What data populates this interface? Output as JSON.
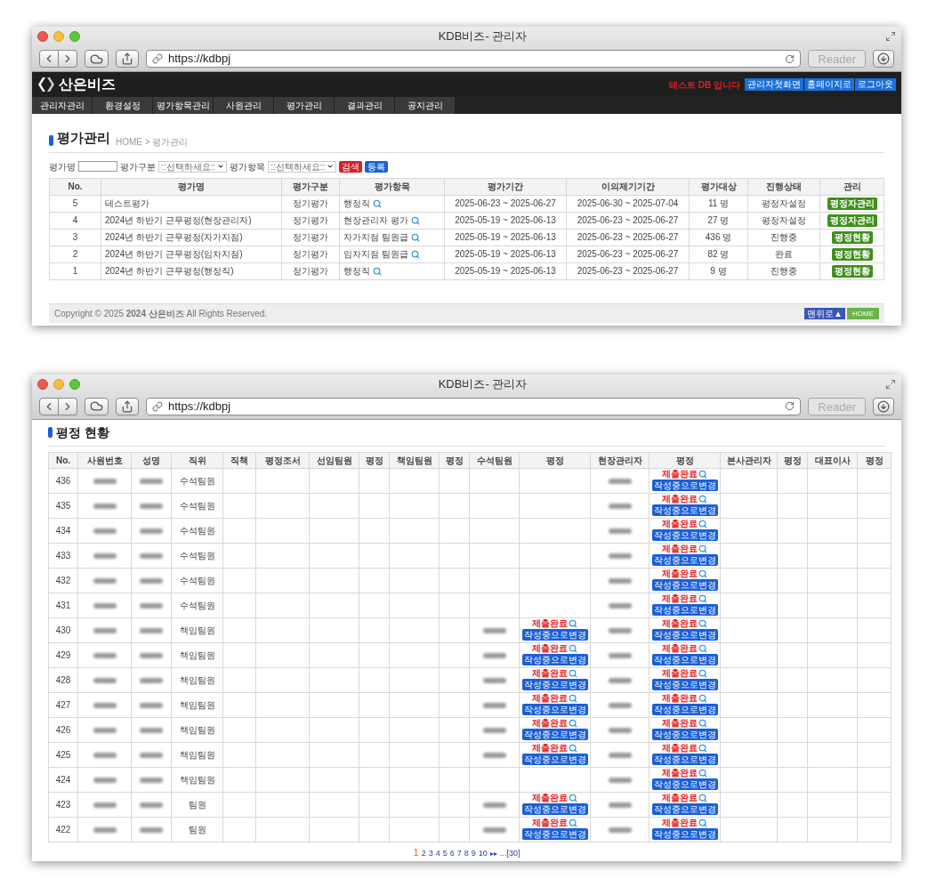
{
  "windows": [
    {
      "kind": "evaluation_list",
      "title": "KDB비즈- 관리자",
      "url": "https://kdbpj",
      "reader": "Reader",
      "brand": "산은비즈",
      "notice": "테스트 DB 입니다",
      "header_links": [
        "관리자첫화면",
        "홈페이지로",
        "로그아웃"
      ],
      "nav": [
        "관리자관리",
        "환경설정",
        "평가항목관리",
        "사원관리",
        "평가관리",
        "결과관리",
        "공지관리"
      ],
      "page_title": "평가관리",
      "breadcrumb": "HOME > 평가관리",
      "filters": [
        {
          "kind": "text",
          "label": "평가명"
        },
        {
          "kind": "select",
          "label": "평가구분",
          "placeholder": "::선택하세요::"
        },
        {
          "kind": "select",
          "label": "평가항목",
          "placeholder": "::선택하세요::"
        }
      ],
      "search_button": "검색",
      "register_button": "등록",
      "table": {
        "columns": [
          "No.",
          "평가명",
          "평가구분",
          "평가항목",
          "평가기간",
          "이의제기기간",
          "평가대상",
          "진행상태",
          "관리"
        ],
        "rows": [
          {
            "no": "5",
            "name": "테스트평가",
            "type": "정기평가",
            "item": "행정직",
            "period": "2025-06-23 ~ 2025-06-27",
            "objection_period": "2025-06-30 ~ 2025-07-04",
            "targets": "11 명",
            "status": "평정자설정",
            "action": "평정자관리"
          },
          {
            "no": "4",
            "name": "2024년 하반기 근무평정(현장관리자)",
            "type": "정기평가",
            "item": "현장관리자 평가",
            "period": "2025-05-19 ~ 2025-06-13",
            "objection_period": "2025-06-23 ~ 2025-06-27",
            "targets": "27 명",
            "status": "평정자설정",
            "action": "평정자관리"
          },
          {
            "no": "3",
            "name": "2024년 하반기 근무평정(자가지점)",
            "type": "정기평가",
            "item": "자가지점 팀원급",
            "period": "2025-05-19 ~ 2025-06-13",
            "objection_period": "2025-06-23 ~ 2025-06-27",
            "targets": "436 명",
            "status": "진행중",
            "action": "평정현황"
          },
          {
            "no": "2",
            "name": "2024년 하반기 근무평정(임차지점)",
            "type": "정기평가",
            "item": "임차지점 팀원급",
            "period": "2025-05-19 ~ 2025-06-13",
            "objection_period": "2025-06-23 ~ 2025-06-27",
            "targets": "82 명",
            "status": "완료",
            "action": "평정현황"
          },
          {
            "no": "1",
            "name": "2024년 하반기 근무평정(행정직)",
            "type": "정기평가",
            "item": "행정직",
            "period": "2025-05-19 ~ 2025-06-13",
            "objection_period": "2025-06-23 ~ 2025-06-27",
            "targets": "9 명",
            "status": "진행중",
            "action": "평정현황"
          }
        ]
      },
      "footer": {
        "copyright": "Copyright © 2025 **2024 산은비즈** All Rights Reserved.",
        "top_button": "맨위로▲",
        "home_button": "HOME"
      }
    },
    {
      "kind": "evaluation_status",
      "title": "KDB비즈- 관리자",
      "url": "https://kdbpj",
      "reader": "Reader",
      "page_title": "평정 현황",
      "table": {
        "columns": [
          "No.",
          "사원번호",
          "성명",
          "직위",
          "직책",
          "평정조서",
          "선임팀원",
          "평정",
          "책임팀원",
          "평정",
          "수석팀원",
          "평정",
          "현장관리자",
          "평정",
          "본사관리자",
          "평정",
          "대표이사",
          "평정"
        ],
        "rows": [
          {
            "no": "436",
            "position": "수석팀원",
            "site_manager_review": {
              "status": "제출완료",
              "action": "작성중으로변경"
            }
          },
          {
            "no": "435",
            "position": "수석팀원",
            "site_manager_review": {
              "status": "제출완료",
              "action": "작성중으로변경"
            }
          },
          {
            "no": "434",
            "position": "수석팀원",
            "site_manager_review": {
              "status": "제출완료",
              "action": "작성중으로변경"
            }
          },
          {
            "no": "433",
            "position": "수석팀원",
            "site_manager_review": {
              "status": "제출완료",
              "action": "작성중으로변경"
            }
          },
          {
            "no": "432",
            "position": "수석팀원",
            "site_manager_review": {
              "status": "제출완료",
              "action": "작성중으로변경"
            }
          },
          {
            "no": "431",
            "position": "수석팀원",
            "site_manager_review": {
              "status": "제출완료",
              "action": "작성중으로변경"
            }
          },
          {
            "no": "430",
            "position": "책임팀원",
            "chief_member_review": {
              "status": "제출완료",
              "action": "작성중으로변경"
            },
            "site_manager_review": {
              "status": "제출완료",
              "action": "작성중으로변경"
            }
          },
          {
            "no": "429",
            "position": "책임팀원",
            "chief_member_review": {
              "status": "제출완료",
              "action": "작성중으로변경"
            },
            "site_manager_review": {
              "status": "제출완료",
              "action": "작성중으로변경"
            }
          },
          {
            "no": "428",
            "position": "책임팀원",
            "chief_member_review": {
              "status": "제출완료",
              "action": "작성중으로변경"
            },
            "site_manager_review": {
              "status": "제출완료",
              "action": "작성중으로변경"
            }
          },
          {
            "no": "427",
            "position": "책임팀원",
            "chief_member_review": {
              "status": "제출완료",
              "action": "작성중으로변경"
            },
            "site_manager_review": {
              "status": "제출완료",
              "action": "작성중으로변경"
            }
          },
          {
            "no": "426",
            "position": "책임팀원",
            "chief_member_review": {
              "status": "제출완료",
              "action": "작성중으로변경"
            },
            "site_manager_review": {
              "status": "제출완료",
              "action": "작성중으로변경"
            }
          },
          {
            "no": "425",
            "position": "책임팀원",
            "chief_member_review": {
              "status": "제출완료",
              "action": "작성중으로변경"
            },
            "site_manager_review": {
              "status": "제출완료",
              "action": "작성중으로변경"
            }
          },
          {
            "no": "424",
            "position": "책임팀원",
            "site_manager_review": {
              "status": "제출완료",
              "action": "작성중으로변경"
            }
          },
          {
            "no": "423",
            "position": "팀원",
            "chief_member_review": {
              "status": "제출완료",
              "action": "작성중으로변경"
            },
            "site_manager_review": {
              "status": "제출완료",
              "action": "작성중으로변경"
            }
          },
          {
            "no": "422",
            "position": "팀원",
            "chief_member_review": {
              "status": "제출완료",
              "action": "작성중으로변경"
            },
            "site_manager_review": {
              "status": "제출완료",
              "action": "작성중으로변경"
            }
          }
        ]
      },
      "pagination": {
        "pages": [
          {
            "label": "1",
            "selected": true
          },
          {
            "label": "2",
            "selected": false
          },
          {
            "label": "3",
            "selected": false
          },
          {
            "label": "4",
            "selected": false
          },
          {
            "label": "5",
            "selected": false
          },
          {
            "label": "6",
            "selected": false
          },
          {
            "label": "7",
            "selected": false
          },
          {
            "label": "8",
            "selected": false
          },
          {
            "label": "9",
            "selected": false
          },
          {
            "label": "10",
            "selected": false
          }
        ],
        "next": "▸▸",
        "last": "...[30]"
      }
    }
  ]
}
